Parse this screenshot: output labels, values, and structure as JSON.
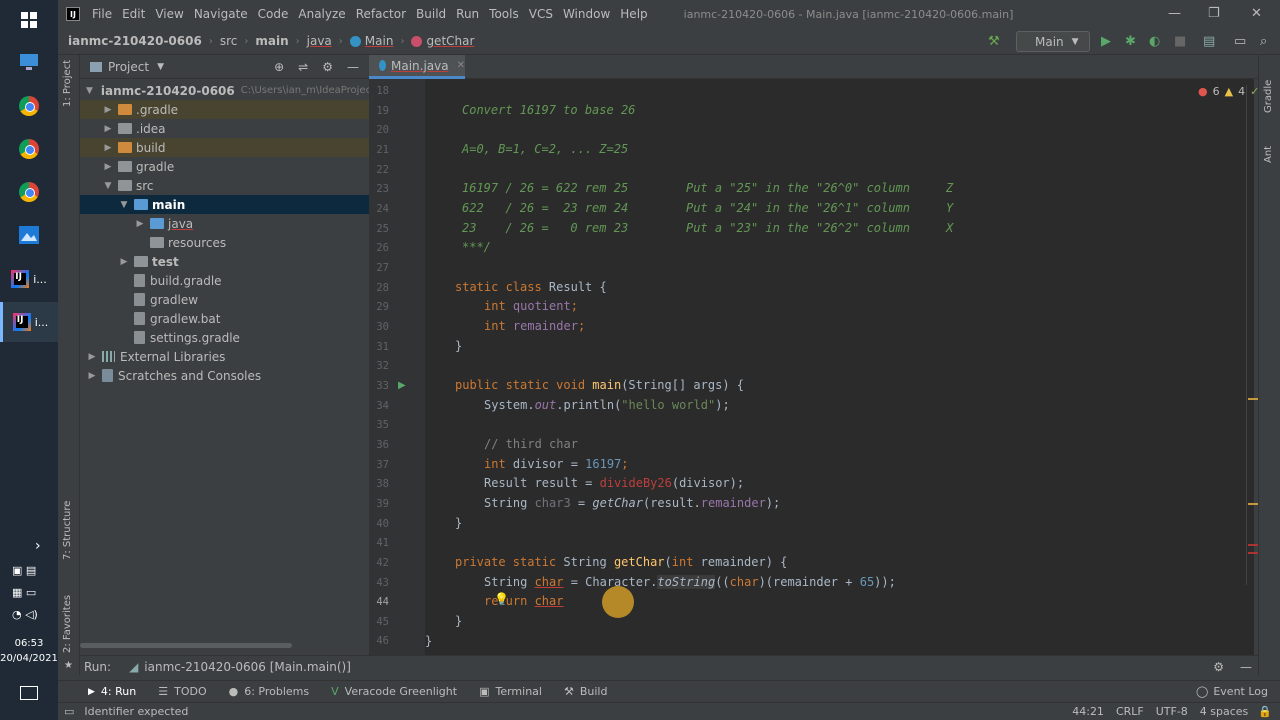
{
  "taskbar": {
    "items": [
      {
        "icon": "windows-start-icon"
      },
      {
        "icon": "remote-desktop-icon"
      },
      {
        "icon": "chrome-icon"
      },
      {
        "icon": "chrome-icon"
      },
      {
        "icon": "chrome-icon"
      },
      {
        "icon": "photos-icon"
      },
      {
        "icon": "intellij-icon",
        "label": "i..."
      },
      {
        "icon": "intellij-icon",
        "label": "i..."
      }
    ],
    "time": "06:53",
    "date": "20/04/2021"
  },
  "menu": {
    "items": [
      "File",
      "Edit",
      "View",
      "Navigate",
      "Code",
      "Analyze",
      "Refactor",
      "Build",
      "Run",
      "Tools",
      "VCS",
      "Window",
      "Help"
    ],
    "window_title": "ianmc-210420-0606 - Main.java [ianmc-210420-0606.main]"
  },
  "breadcrumb": {
    "items": [
      "ianmc-210420-0606",
      "src",
      "main",
      "java",
      "Main",
      "getChar"
    ],
    "run_config": "Main"
  },
  "project_panel": {
    "title": "Project",
    "root": {
      "name": "ianmc-210420-0606",
      "path": "C:\\Users\\ian_m\\IdeaProjects"
    },
    "tree": [
      {
        "name": ".gradle"
      },
      {
        "name": ".idea"
      },
      {
        "name": "build"
      },
      {
        "name": "gradle"
      },
      {
        "name": "src"
      },
      {
        "name": "main"
      },
      {
        "name": "java"
      },
      {
        "name": "resources"
      },
      {
        "name": "test"
      },
      {
        "name": "build.gradle"
      },
      {
        "name": "gradlew"
      },
      {
        "name": "gradlew.bat"
      },
      {
        "name": "settings.gradle"
      },
      {
        "name": "External Libraries"
      },
      {
        "name": "Scratches and Consoles"
      }
    ]
  },
  "left_strip": {
    "project": "1: Project",
    "structure": "7: Structure",
    "favorites": "2: Favorites"
  },
  "right_strip": {
    "gradle": "Gradle",
    "ant": "Ant"
  },
  "editor": {
    "tab": "Main.java",
    "inspection": {
      "errors": "6",
      "warnings": "4",
      "ok": "1"
    },
    "line_numbers": [
      "18",
      "19",
      "20",
      "21",
      "22",
      "23",
      "24",
      "25",
      "26",
      "27",
      "28",
      "29",
      "30",
      "31",
      "32",
      "33",
      "34",
      "35",
      "36",
      "37",
      "38",
      "39",
      "40",
      "41",
      "42",
      "43",
      "44",
      "45",
      "46"
    ],
    "code": {
      "l19": "Convert 16197 to base 26",
      "l21": "A=0, B=1, C=2, ... Z=25",
      "l23": "16197 / 26 = 622 rem 25        Put a \"25\" in the \"26^0\" column     Z",
      "l24": "622   / 26 =  23 rem 24        Put a \"24\" in the \"26^1\" column     Y",
      "l25": "23    / 26 =   0 rem 23        Put a \"23\" in the \"26^2\" column     X",
      "l26": "***/",
      "l28_kw": "static class ",
      "l28_rest": "Result {",
      "l29_kw": "int ",
      "l29_fld": "quotient",
      "l30_kw": "int ",
      "l30_fld": "remainder",
      "l31": "}",
      "l33_kw": "public static void ",
      "l33_fn": "main",
      "l33_rest": "(String[] args) {",
      "l34_a": "System.",
      "l34_out": "out",
      "l34_b": ".println(",
      "l34_str": "\"hello world\"",
      "l34_c": ");",
      "l36": "// third char",
      "l37_kw": "int ",
      "l37_a": "divisor = ",
      "l37_num": "16197",
      "l37_b": ";",
      "l38_a": "Result result = ",
      "l38_err": "divideBy26",
      "l38_b": "(divisor);",
      "l39_a": "String ",
      "l39_var": "char3",
      "l39_b": " = ",
      "l39_fn": "getChar",
      "l39_c": "(result.",
      "l39_fld": "remainder",
      "l39_d": ");",
      "l40": "}",
      "l42_kw": "private static ",
      "l42_a": "String ",
      "l42_fn": "getChar",
      "l42_b": "(",
      "l42_kw2": "int ",
      "l42_c": "remainder) {",
      "l43_a": "String ",
      "l43_var": "char",
      "l43_b": " = Character.",
      "l43_fn": "toString",
      "l43_c": "((",
      "l43_kw": "char",
      "l43_d": ")(remainder + ",
      "l43_num": "65",
      "l43_e": "));",
      "l44_kw": "return ",
      "l44_err": "char",
      "l45": "}",
      "l46": "}"
    }
  },
  "run_bar": {
    "label": "Run:",
    "config": "ianmc-210420-0606 [Main.main()]"
  },
  "tool_windows": [
    "4: Run",
    "TODO",
    "6: Problems",
    "Veracode Greenlight",
    "Terminal",
    "Build"
  ],
  "event_log": "Event Log",
  "status": {
    "message": "Identifier expected",
    "position": "44:21",
    "line_sep": "CRLF",
    "encoding": "UTF-8",
    "indent": "4 spaces"
  },
  "colors": {
    "accent": "#4a88c7",
    "keyword": "#cc7832",
    "string": "#6a8759",
    "error": "#bc3f3c"
  }
}
